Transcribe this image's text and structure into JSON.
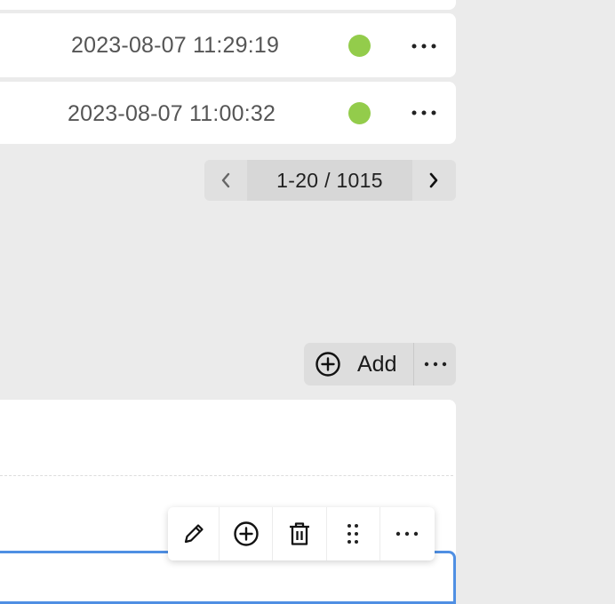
{
  "rows": [
    {
      "timestamp": "2023-08-07 11:29:19",
      "status_color": "#93cc4b",
      "more_icon": "more-horizontal-icon"
    },
    {
      "timestamp": "2023-08-07 11:00:32",
      "status_color": "#93cc4b",
      "more_icon": "more-horizontal-icon"
    }
  ],
  "pagination": {
    "range_label": "1-20 / 1015",
    "prev_icon": "chevron-left-icon",
    "next_icon": "chevron-right-icon"
  },
  "block_actions": {
    "add_label": "Add",
    "add_icon": "plus-circle-icon",
    "more_icon": "more-horizontal-icon"
  },
  "block_toolbar": {
    "items": [
      "edit-icon",
      "plus-circle-icon",
      "delete-icon",
      "drag-handle-icon",
      "more-horizontal-icon"
    ]
  },
  "colors": {
    "accent_border": "#4f8fe3",
    "status_ok": "#93cc4b"
  }
}
